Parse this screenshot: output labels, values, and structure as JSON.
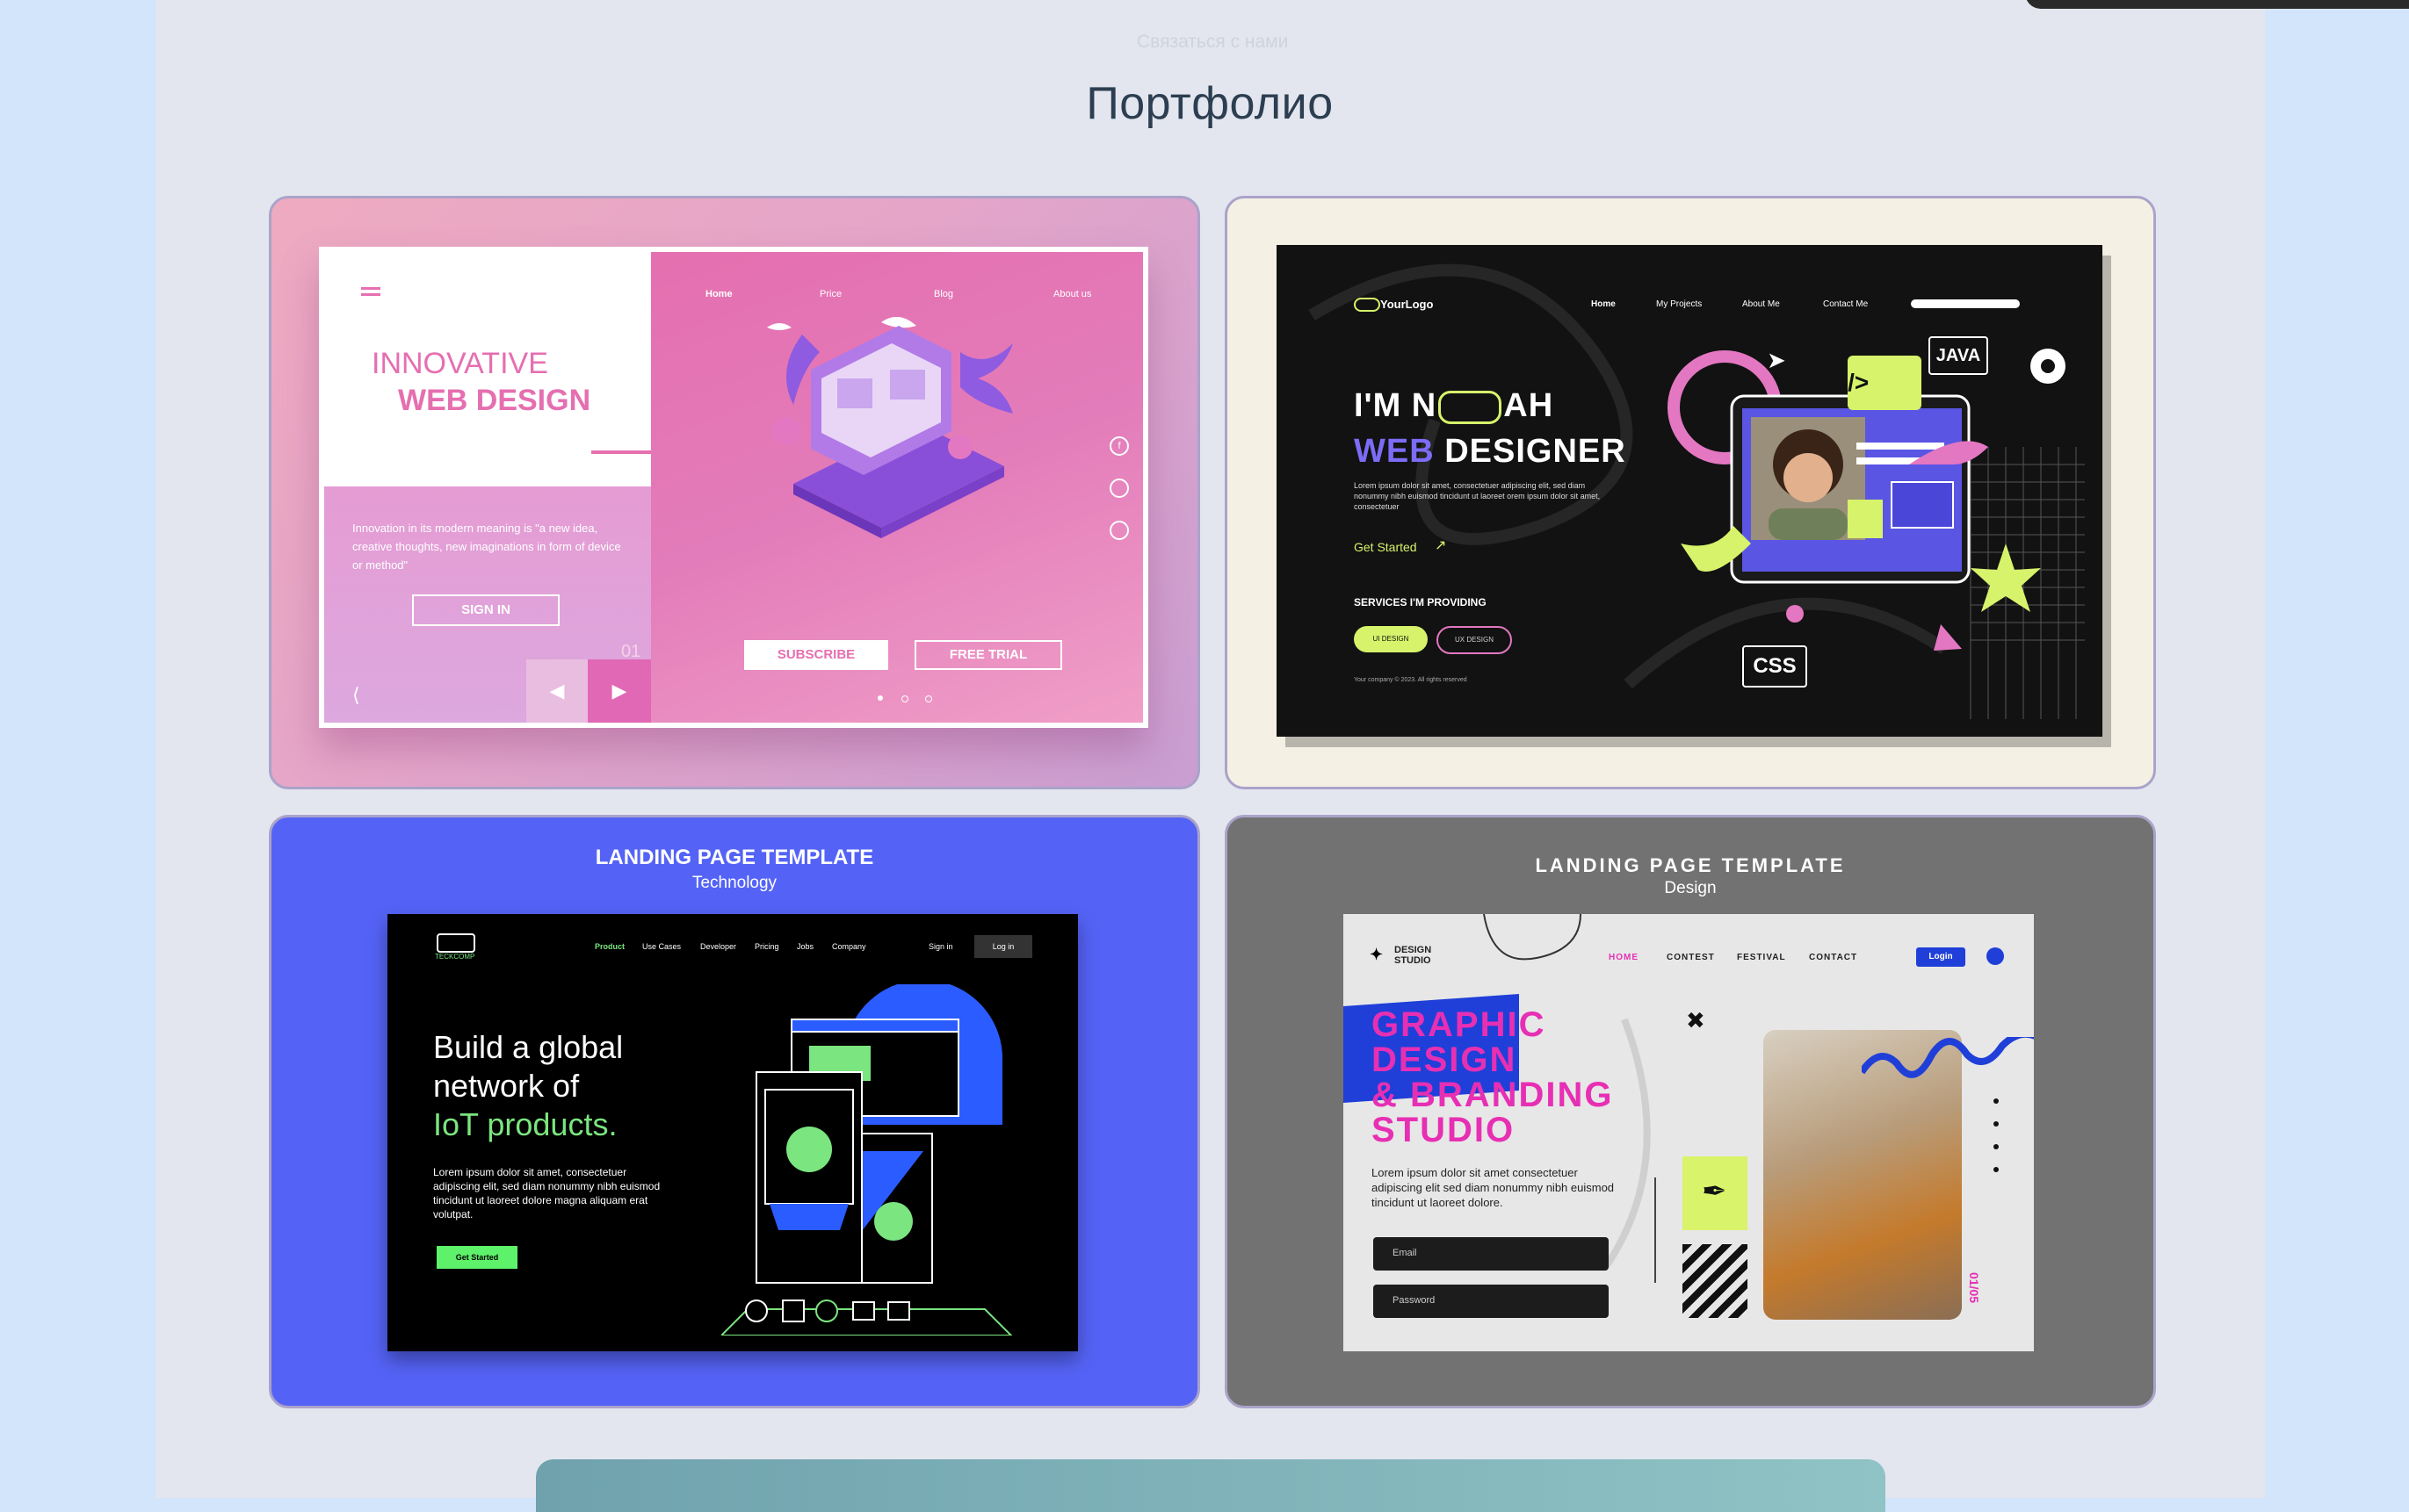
{
  "page": {
    "nav_link": "Связаться с нами",
    "title": "Портфолио"
  },
  "colors": {
    "background": "#d3e5fb",
    "panel": "#e3e6ef",
    "title": "#2c3e50",
    "card_border": "#aaa3c9",
    "card3_bg": "#5463f6",
    "card4_bg": "#727272"
  },
  "cards": [
    {
      "nav": [
        "Home",
        "Price",
        "Blog",
        "About us"
      ],
      "headline_1": "INNOVATIVE",
      "headline_2": "WEB DESIGN",
      "description": "Innovation in its modern meaning is \"a new idea, creative thoughts, new imaginations in form of device or method\"",
      "signin": "SIGN IN",
      "slide_number": "01",
      "subscribe": "SUBSCRIBE",
      "free_trial": "FREE TRIAL",
      "icons": [
        "hamburger-icon",
        "facebook-icon",
        "instagram-icon",
        "twitter-icon",
        "share-icon",
        "arrow-left-icon",
        "arrow-right-icon"
      ]
    },
    {
      "logo": "YourLogo",
      "nav": [
        "Home",
        "My Projects",
        "About Me",
        "Contact Me"
      ],
      "headline_1a": "I'M N",
      "headline_1b": "AH",
      "headline_2a": "WEB",
      "headline_2b": "DESIGNER",
      "description": "Lorem ipsum dolor sit amet, consectetuer adipiscing elit, sed diam nonummy nibh euismod tincidunt ut laoreet orem ipsum dolor sit amet, consectetuer",
      "cta": "Get Started",
      "services_title": "SERVICES I'M PROVIDING",
      "service_1": "UI DESIGN",
      "service_2": "UX DESIGN",
      "copyright": "Your company © 2023. All rights reserved",
      "tag_java": "JAVA",
      "tag_code": "</>",
      "tag_css": "CSS"
    },
    {
      "title": "LANDING PAGE TEMPLATE",
      "subtitle": "Technology",
      "logo": "TECKCOMP",
      "nav": [
        "Product",
        "Use Cases",
        "Developer",
        "Pricing",
        "Jobs",
        "Company"
      ],
      "signin": "Sign in",
      "login": "Log in",
      "headline_1": "Build a global",
      "headline_2": "network of",
      "headline_3": "IoT products.",
      "description": "Lorem ipsum dolor sit amet, consectetuer adipiscing elit, sed diam nonummy nibh euismod tincidunt ut laoreet dolore magna aliquam erat volutpat.",
      "cta": "Get Started"
    },
    {
      "title": "LANDING PAGE TEMPLATE",
      "subtitle": "Design",
      "logo_1": "DESIGN",
      "logo_2": "STUDIO",
      "nav": [
        "HOME",
        "CONTEST",
        "FESTIVAL",
        "CONTACT"
      ],
      "login": "Login",
      "headline_1": "GRAPHIC",
      "headline_2": "DESIGN",
      "headline_3": "& BRANDING",
      "headline_4": "STUDIO",
      "description": "Lorem ipsum dolor sit amet consectetuer adipiscing elit sed diam nonummy nibh euismod tincidunt ut laoreet dolore.",
      "email_placeholder": "Email",
      "password_placeholder": "Password",
      "page_counter": "01/05"
    }
  ]
}
